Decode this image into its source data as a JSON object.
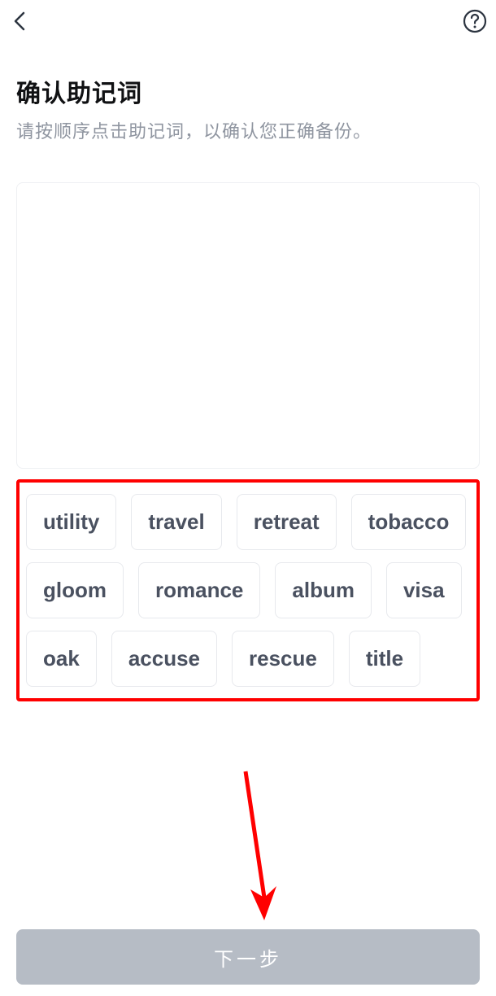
{
  "header": {
    "title": "确认助记词",
    "subtitle": "请按顺序点击助记词，以确认您正确备份。"
  },
  "words": [
    "utility",
    "travel",
    "retreat",
    "tobacco",
    "gloom",
    "romance",
    "album",
    "visa",
    "oak",
    "accuse",
    "rescue",
    "title"
  ],
  "buttons": {
    "next": "下一步"
  },
  "annotation": {
    "highlight_border_color": "#ff0000",
    "arrow_color": "#ff0000"
  }
}
